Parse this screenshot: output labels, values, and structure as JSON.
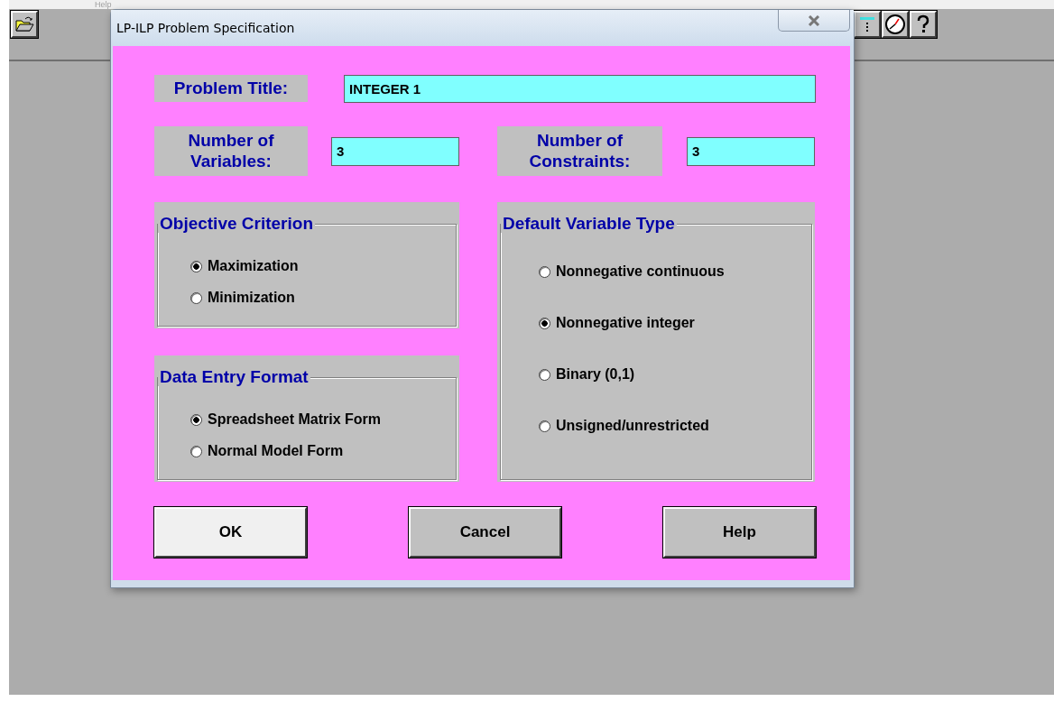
{
  "menu": [
    {
      "label": "Help"
    }
  ],
  "dialog": {
    "title": "LP-ILP Problem Specification",
    "problem_title": {
      "label": "Problem Title:",
      "value": "INTEGER 1"
    },
    "counts": [
      {
        "label": "Number of\nVariables:",
        "value": "3"
      },
      {
        "label": "Number of\nConstraints:",
        "value": "3"
      }
    ],
    "groups": [
      {
        "kind": "objective",
        "title": "Objective Criterion",
        "options": [
          {
            "label": "Maximization",
            "selected": true
          },
          {
            "label": "Minimization",
            "selected": false
          }
        ]
      },
      {
        "kind": "variable_type",
        "title": "Default Variable Type",
        "options": [
          {
            "label": "Nonnegative continuous",
            "selected": false
          },
          {
            "label": "Nonnegative integer",
            "selected": true
          },
          {
            "label": "Binary (0,1)",
            "selected": false
          },
          {
            "label": "Unsigned/unrestricted",
            "selected": false
          }
        ]
      },
      {
        "kind": "entry_format",
        "title": "Data Entry Format",
        "options": [
          {
            "label": "Spreadsheet Matrix Form",
            "selected": true
          },
          {
            "label": "Normal Model Form",
            "selected": false
          }
        ]
      }
    ],
    "buttons": [
      {
        "label": "OK",
        "kind": "default"
      },
      {
        "label": "Cancel",
        "kind": "normal"
      },
      {
        "label": "Help",
        "kind": "normal"
      }
    ]
  }
}
